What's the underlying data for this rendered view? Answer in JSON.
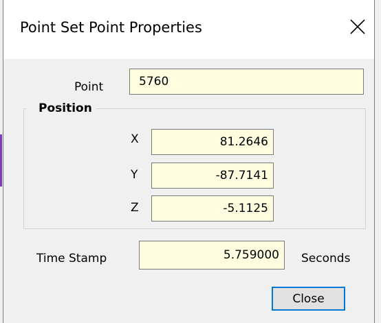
{
  "window": {
    "title": "Point Set Point Properties"
  },
  "point": {
    "label": "Point",
    "value": "5760"
  },
  "position": {
    "group_label": "Position",
    "x_label": "X",
    "x_value": "81.2646",
    "y_label": "Y",
    "y_value": "-87.7141",
    "z_label": "Z",
    "z_value": "-5.1125"
  },
  "time_stamp": {
    "label": "Time Stamp",
    "value": "5.759000",
    "unit": "Seconds"
  },
  "buttons": {
    "close_label": "Close"
  },
  "icons": {
    "window_close": "close-icon"
  },
  "colors": {
    "field_background": "#fffee0",
    "dialog_background": "#f0f0f0",
    "focus_border": "#0078d7"
  }
}
